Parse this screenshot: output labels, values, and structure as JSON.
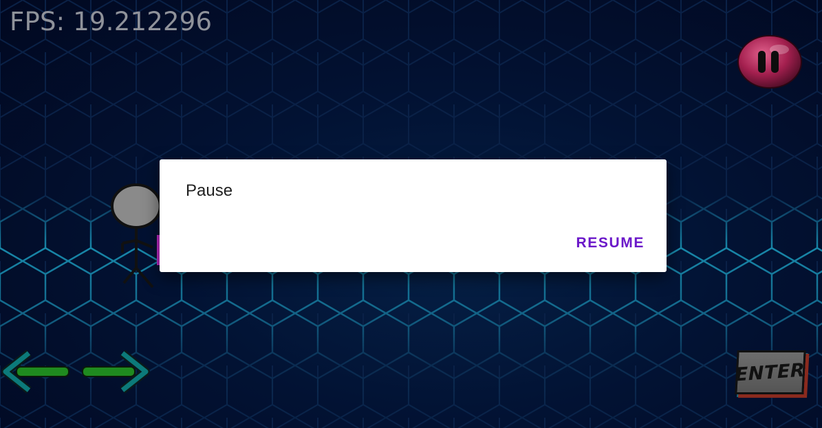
{
  "hud": {
    "fps_text": "FPS: 19.212296"
  },
  "controls": {
    "pause_icon": "pause-icon",
    "left_icon": "left-arrow-icon",
    "right_icon": "right-arrow-icon",
    "enter_label": "ENTER"
  },
  "dialog": {
    "title": "Pause",
    "resume_label": "RESUME"
  },
  "colors": {
    "background": "#010a22",
    "hex_glow": "#1fb8d8",
    "dialog_bg": "#ffffff",
    "resume_accent": "#6b18c9",
    "arrow_green": "#1f8a1f",
    "arrow_teal": "#0c7a7a",
    "pause_orb": "#a4204f"
  }
}
